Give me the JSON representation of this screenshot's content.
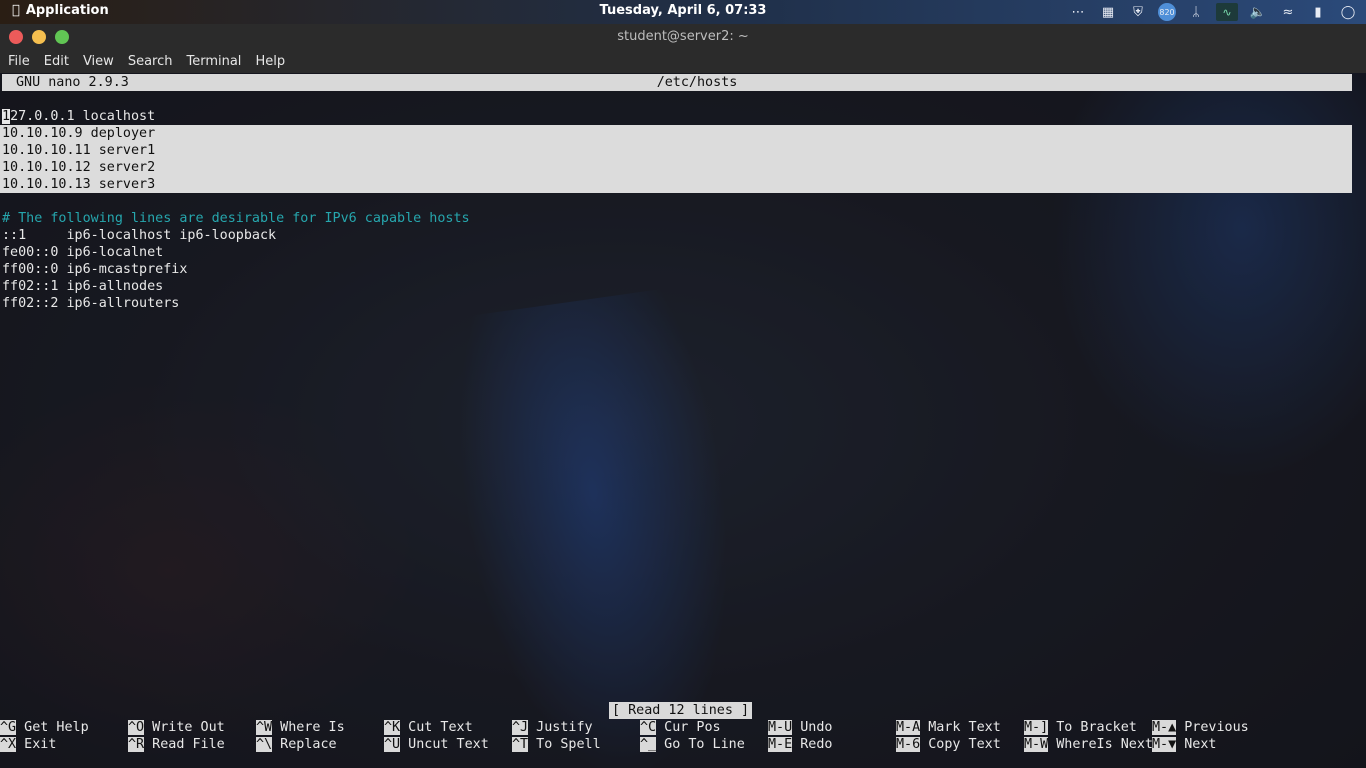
{
  "topbar": {
    "app_label": "Application",
    "clock": "Tuesday, April  6, 07:33",
    "tray_icons": [
      "more-icon",
      "apps-grid-icon",
      "shield-icon",
      "telegram-icon",
      "bluetooth-icon",
      "system-monitor-icon",
      "volume-icon",
      "wifi-icon",
      "battery-icon",
      "user-icon"
    ],
    "badge_text": "820"
  },
  "window": {
    "title": "student@server2: ~"
  },
  "menu": [
    "File",
    "Edit",
    "View",
    "Search",
    "Terminal",
    "Help"
  ],
  "nano": {
    "version": "GNU nano 2.9.3",
    "filename": "/etc/hosts",
    "cursor_char": "1",
    "lines": {
      "l1_rest": "27.0.0.1 localhost",
      "l2": "10.10.10.9 deployer",
      "l3": "10.10.10.11 server1",
      "l4": "10.10.10.12 server2",
      "l5": "10.10.10.13 server3",
      "l6": "",
      "l7": "# The following lines are desirable for IPv6 capable hosts",
      "l8": "::1     ip6-localhost ip6-loopback",
      "l9": "fe00::0 ip6-localnet",
      "l10": "ff00::0 ip6-mcastprefix",
      "l11": "ff02::1 ip6-allnodes",
      "l12": "ff02::2 ip6-allrouters"
    },
    "status": "[ Read 12 lines ]",
    "shortcuts": [
      {
        "key": "^G",
        "label": " Get Help"
      },
      {
        "key": "^X",
        "label": " Exit"
      },
      {
        "key": "^O",
        "label": " Write Out"
      },
      {
        "key": "^R",
        "label": " Read File"
      },
      {
        "key": "^W",
        "label": " Where Is"
      },
      {
        "key": "^\\",
        "label": " Replace"
      },
      {
        "key": "^K",
        "label": " Cut Text"
      },
      {
        "key": "^U",
        "label": " Uncut Text"
      },
      {
        "key": "^J",
        "label": " Justify"
      },
      {
        "key": "^T",
        "label": " To Spell"
      },
      {
        "key": "^C",
        "label": " Cur Pos"
      },
      {
        "key": "^_",
        "label": " Go To Line"
      },
      {
        "key": "M-U",
        "label": " Undo"
      },
      {
        "key": "M-E",
        "label": " Redo"
      },
      {
        "key": "M-A",
        "label": " Mark Text"
      },
      {
        "key": "M-6",
        "label": " Copy Text"
      },
      {
        "key": "M-]",
        "label": " To Bracket"
      },
      {
        "key": "M-W",
        "label": " WhereIs Next"
      },
      {
        "key": "M-▲",
        "label": " Previous"
      },
      {
        "key": "M-▼",
        "label": " Next"
      }
    ]
  }
}
